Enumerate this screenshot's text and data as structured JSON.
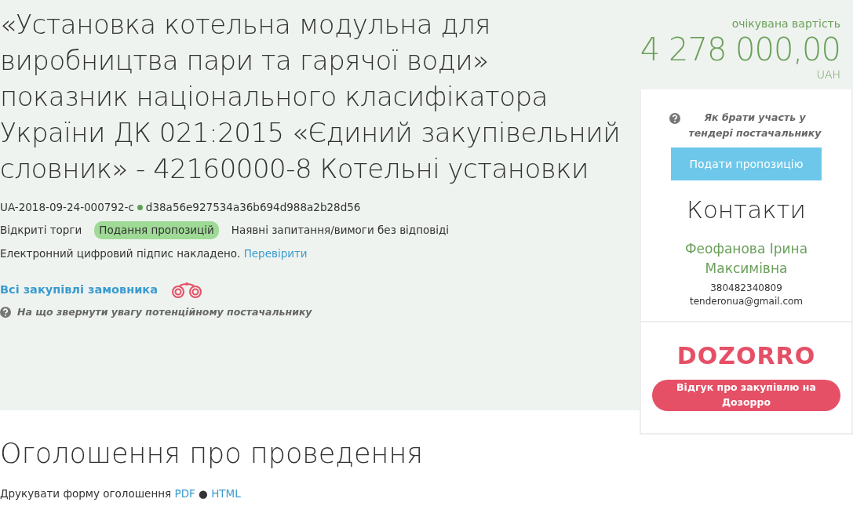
{
  "header": {
    "title": "«Установка котельна модульна для виробництва пари та гарячої води» показник національного класифікатора України ДК 021:2015 «Єдиний закупівельний словник» - 42160000-8 Котельні установки",
    "tender_id": "UA-2018-09-24-000792-c",
    "hash": "d38a56e927534a36b694d988a2b28d56",
    "procedure_type": "Відкриті торги",
    "status": "Подання пропозицій",
    "questions_note": "Наявні запитання/вимоги без відповіді",
    "signature_text": "Електронний цифровий підпис накладено.",
    "signature_link": "Перевірити",
    "all_purchases_link": "Всі закупівлі замовника",
    "supplier_hint": "На що звернути увагу потенційному постачальнику"
  },
  "sidebar": {
    "value_label": "очікувана вартість",
    "amount": "4 278 000,00",
    "currency": "UAH",
    "help_link": "Як брати участь у тендері постачальнику",
    "submit_button": "Подати пропозицію",
    "contacts_heading": "Контакти",
    "contact_name": "Феофанова Ірина Максимівна",
    "phone": "380482340809",
    "email": "tenderonua@gmail.com",
    "logo": "DOZORRO",
    "feedback_button": "Відгук про закупівлю на Дозорро"
  },
  "announcement": {
    "heading": "Оголошення про проведення",
    "print_text": "Друкувати форму оголошення",
    "pdf_link": "PDF",
    "separator": "●",
    "html_link": "HTML"
  }
}
